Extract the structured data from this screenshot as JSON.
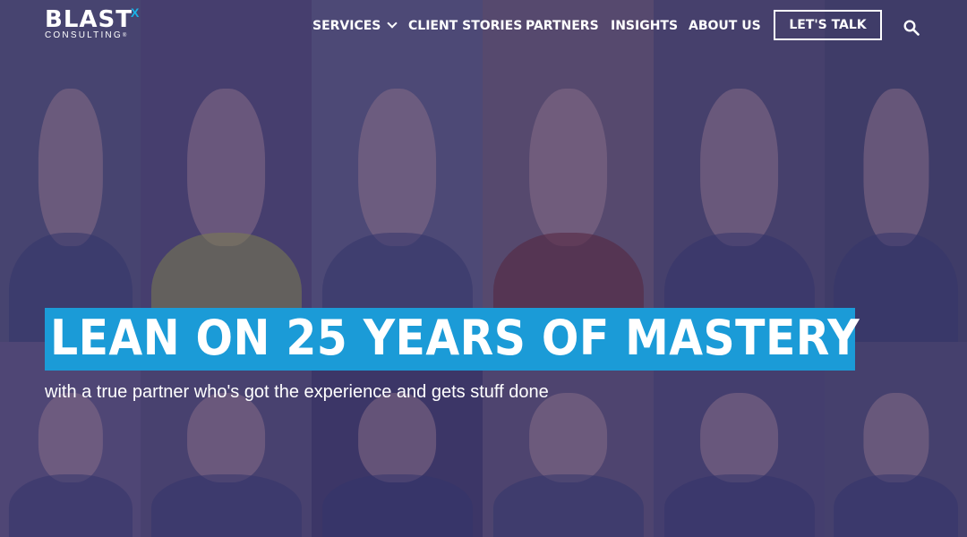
{
  "brand": {
    "name": "BLAST",
    "mark": "X",
    "tagline": "CONSULTING",
    "reg": "®"
  },
  "nav": {
    "items": [
      {
        "label": "SERVICES",
        "has_dropdown": true
      },
      {
        "label": "CLIENT STORIES"
      },
      {
        "label": "PARTNERS"
      },
      {
        "label": "INSIGHTS"
      },
      {
        "label": "ABOUT US"
      }
    ],
    "cta_label": "LET'S TALK"
  },
  "hero": {
    "headline": "LEAN ON 25 YEARS OF MASTERY",
    "subhead": "with a true partner who's got the experience and gets stuff done"
  },
  "colors": {
    "accent": "#1b9bd7",
    "overlay": "#2a2269",
    "text": "#ffffff"
  }
}
